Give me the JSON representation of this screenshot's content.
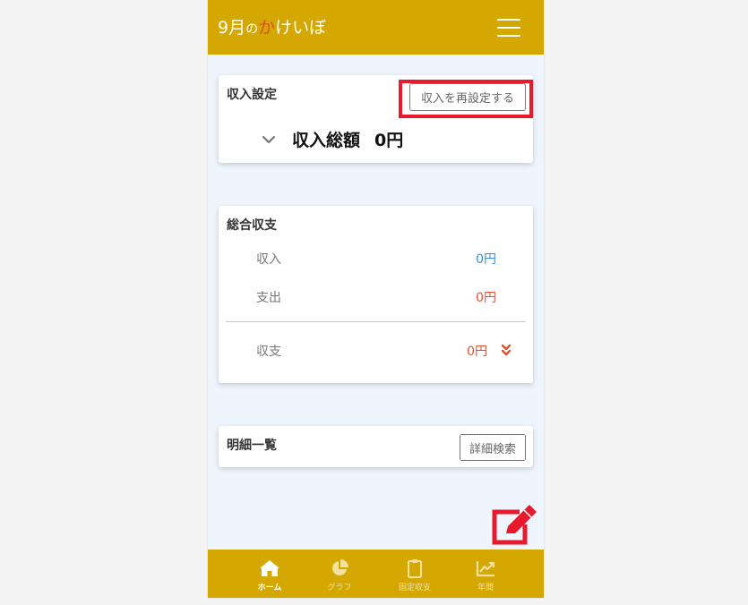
{
  "header": {
    "title_month": "9月",
    "title_no": "の",
    "title_ka": "か",
    "title_rest": "けいぼ"
  },
  "income_settings": {
    "title": "収入設定",
    "reset_button": "収入を再設定する",
    "total_label": "収入総額",
    "total_value": "0円"
  },
  "summary": {
    "title": "総合収支",
    "rows": [
      {
        "label": "収入",
        "value": "0円"
      },
      {
        "label": "支出",
        "value": "0円"
      },
      {
        "label": "収支",
        "value": "0円"
      }
    ]
  },
  "details": {
    "title": "明細一覧",
    "search_button": "詳細検索"
  },
  "nav": {
    "items": [
      {
        "label": "ホーム",
        "icon": "home-icon",
        "active": true
      },
      {
        "label": "グラフ",
        "icon": "pie-chart-icon",
        "active": false
      },
      {
        "label": "固定収支",
        "icon": "clipboard-icon",
        "active": false
      },
      {
        "label": "年間",
        "icon": "line-chart-icon",
        "active": false
      }
    ]
  },
  "colors": {
    "brand": "#d4a800",
    "accent": "#e0502c",
    "income": "#3a8fd0",
    "expense": "#e0502c",
    "highlight": "#e8192c"
  }
}
